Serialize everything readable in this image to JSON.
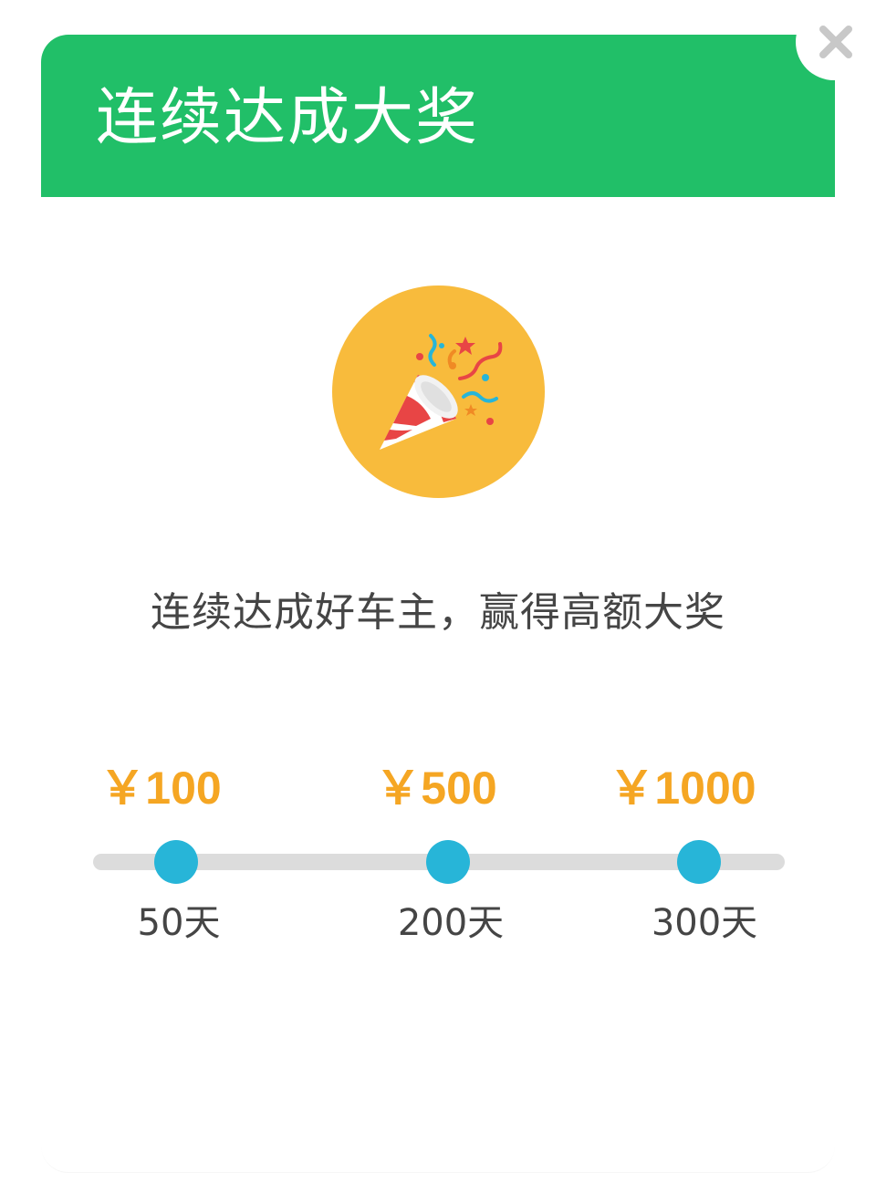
{
  "dialog": {
    "title": "连续达成大奖",
    "tagline": "连续达成好车主，赢得高额大奖",
    "close_icon": "close-icon",
    "badge_icon": "party-popper-icon"
  },
  "milestones": [
    {
      "reward": "￥100",
      "days": "50天"
    },
    {
      "reward": "￥500",
      "days": "200天"
    },
    {
      "reward": "￥1000",
      "days": "300天"
    }
  ],
  "colors": {
    "header": "#21bf68",
    "badge_bg": "#f8bb3c",
    "reward": "#f5a623",
    "dot": "#27b5d8",
    "track": "#dcdcdc",
    "text": "#454545"
  }
}
